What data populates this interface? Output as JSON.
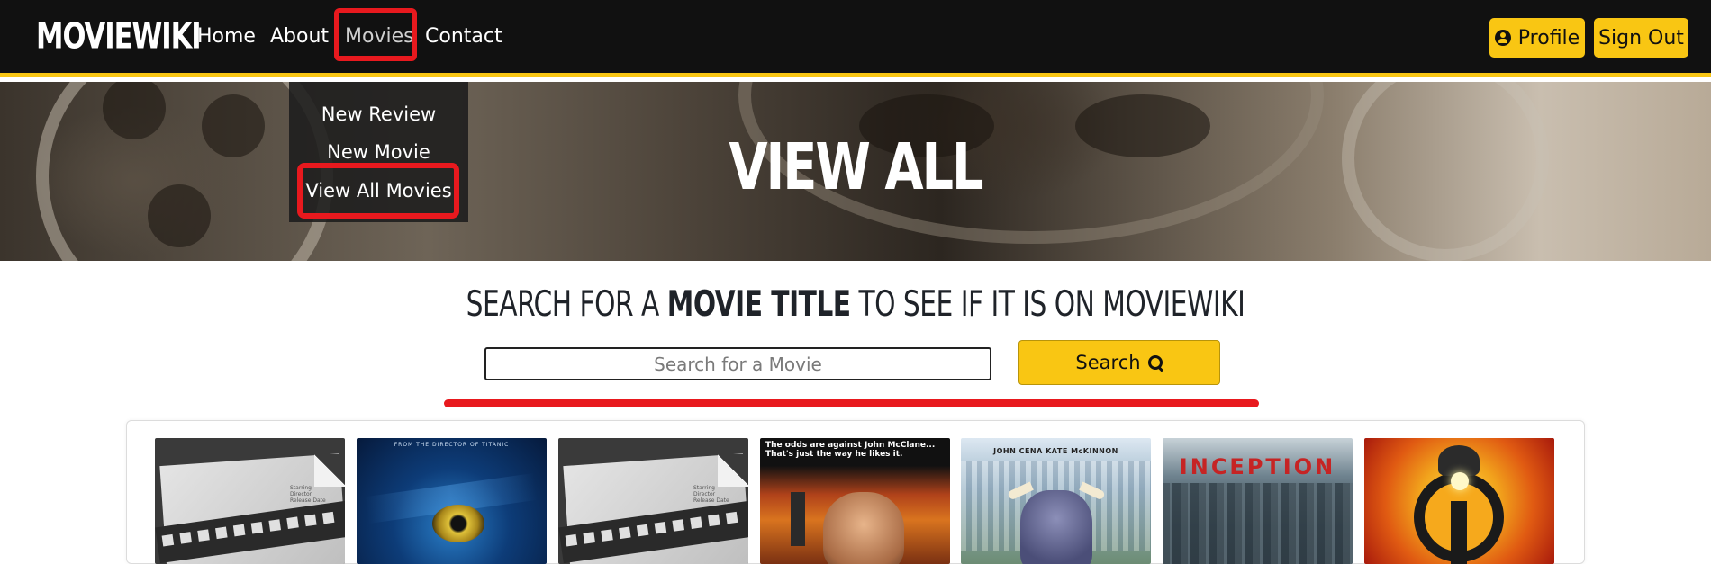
{
  "brand": "MOVIEWIKI",
  "nav": {
    "home": "Home",
    "about": "About",
    "movies": "Movies",
    "contact": "Contact"
  },
  "account": {
    "profile_label": "Profile",
    "signout_label": "Sign Out"
  },
  "movies_dropdown": {
    "items": [
      "New Review",
      "New Movie",
      "View All Movies"
    ]
  },
  "hero": {
    "title": "VIEW ALL"
  },
  "search": {
    "heading_pre": "SEARCH FOR A ",
    "heading_bold": "MOVIE TITLE",
    "heading_post": " TO SEE IF IT IS ON MOVIEWIKI",
    "placeholder": "Search for a Movie",
    "value": "",
    "button_label": "Search"
  },
  "posters": {
    "avatar_tagline": "FROM THE DIRECTOR OF TITANIC",
    "diehard_tagline": "The odds are against John McClane... That's just the way he likes it.",
    "ferdinand_names": "JOHN CENA    KATE McKINNON",
    "inception_title": "INCEPTION",
    "placeholder_note": "Starring Director Release Date"
  },
  "colors": {
    "accent": "#f9c613",
    "navbar_bg": "#111111",
    "annotation_red": "#e8191e"
  },
  "icons": {
    "profile": "user-circle-icon",
    "search": "magnifying-glass-icon"
  }
}
